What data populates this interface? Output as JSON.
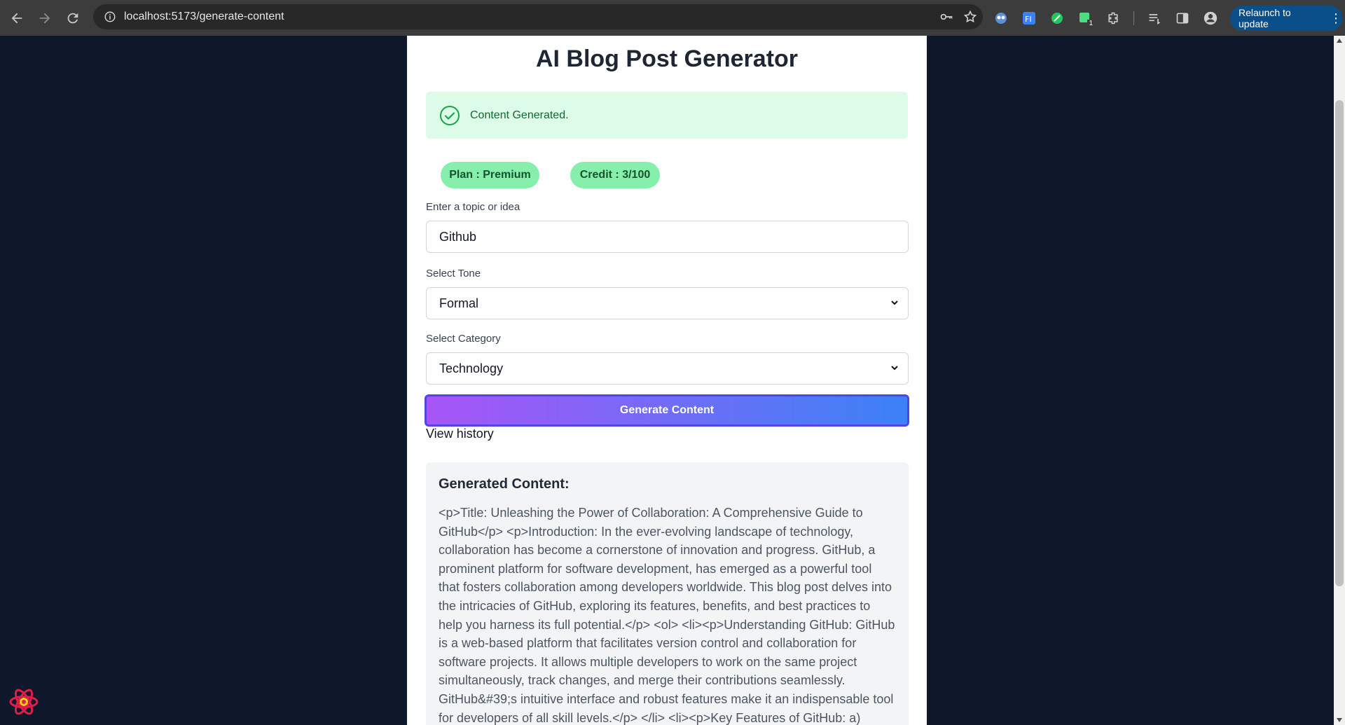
{
  "browser": {
    "url": "localhost:5173/generate-content",
    "relaunch_label": "Relaunch to update",
    "extension_badge": "1"
  },
  "page": {
    "title": "AI Blog Post Generator",
    "alert_text": "Content Generated.",
    "plan_label": "Plan : Premium",
    "credit_label": "Credit : 3/100",
    "topic_label": "Enter a topic or idea",
    "topic_value": "Github",
    "tone_label": "Select Tone",
    "tone_value": "Formal",
    "category_label": "Select Category",
    "category_value": "Technology",
    "generate_button": "Generate Content",
    "history_link": "View history",
    "generated_title": "Generated Content:",
    "generated_body": "<p>Title: Unleashing the Power of Collaboration: A Comprehensive Guide to GitHub</p> <p>Introduction: In the ever-evolving landscape of technology, collaboration has become a cornerstone of innovation and progress. GitHub, a prominent platform for software development, has emerged as a powerful tool that fosters collaboration among developers worldwide. This blog post delves into the intricacies of GitHub, exploring its features, benefits, and best practices to help you harness its full potential.</p> <ol> <li><p>Understanding GitHub: GitHub is a web-based platform that facilitates version control and collaboration for software projects. It allows multiple developers to work on the same project simultaneously, track changes, and merge their contributions seamlessly. GitHub&#39;s intuitive interface and robust features make it an indispensable tool for developers of all skill levels.</p> </li> <li><p>Key Features of GitHub: a) Version Control: GitHub"
  },
  "colors": {
    "page_bg": "#0f172a",
    "alert_bg": "#dcfce7",
    "pill_bg": "#86efac",
    "button_gradient_start": "#a855f7",
    "button_gradient_end": "#3b82f6"
  }
}
